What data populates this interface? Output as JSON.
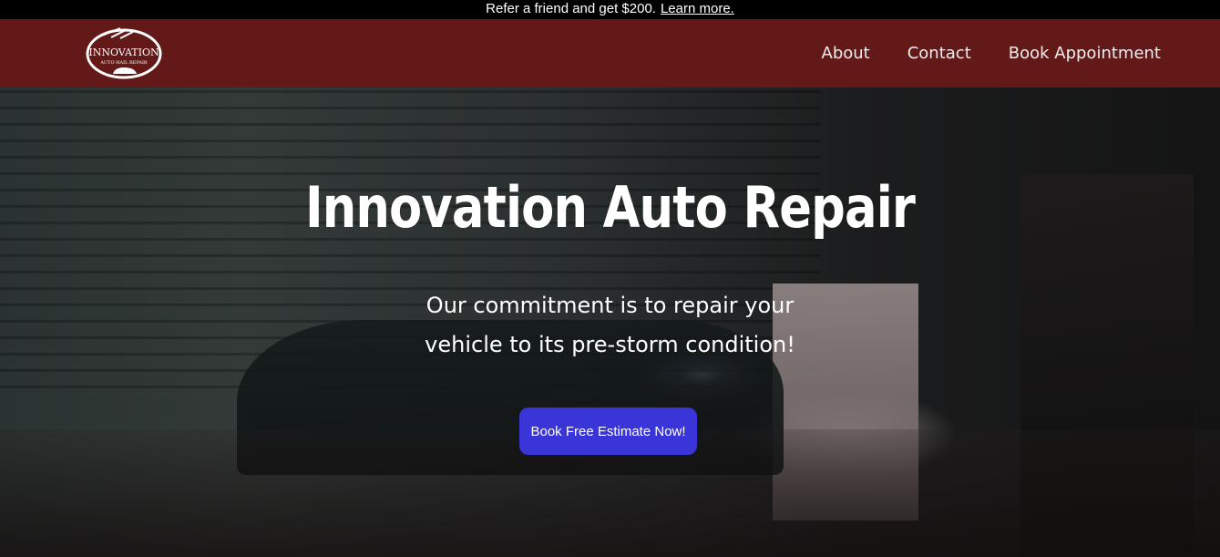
{
  "promo": {
    "text": "Refer a friend and get $200.",
    "link": "Learn more."
  },
  "logo": {
    "line1": "INNOVATION",
    "line2": "AUTO HAIL REPAIR"
  },
  "nav": {
    "items": [
      "About",
      "Contact",
      "Book Appointment"
    ]
  },
  "hero": {
    "title": "Innovation Auto Repair",
    "subtitle_line1": "Our commitment is to repair your",
    "subtitle_line2": "vehicle to its pre-storm condition!",
    "cta": "Book Free Estimate Now!"
  },
  "colors": {
    "nav_bg": "#641919",
    "cta_bg": "#3a35d8",
    "topbar_bg": "#000000"
  }
}
